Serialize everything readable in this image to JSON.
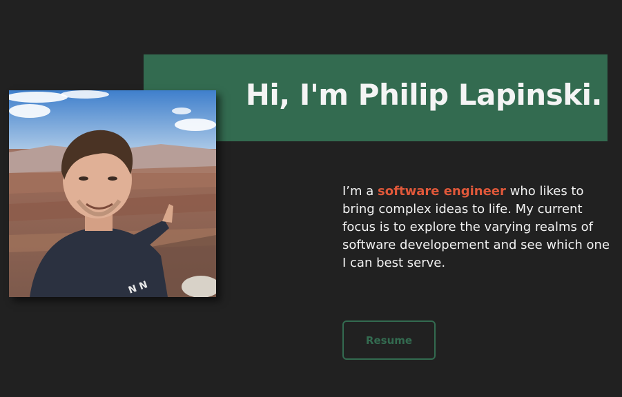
{
  "hero": {
    "title": "Hi, I'm Philip Lapinski.",
    "intro_prefix": "I’m a ",
    "intro_highlight": "software engineer",
    "intro_suffix": " who likes to bring complex ideas to life. My current focus is to explore the varying realms of software developement and see which one I can best serve.",
    "resume_label": "Resume"
  },
  "colors": {
    "background": "#212121",
    "banner": "#336b50",
    "accent": "#e0583a",
    "text": "#f2f2f2"
  }
}
